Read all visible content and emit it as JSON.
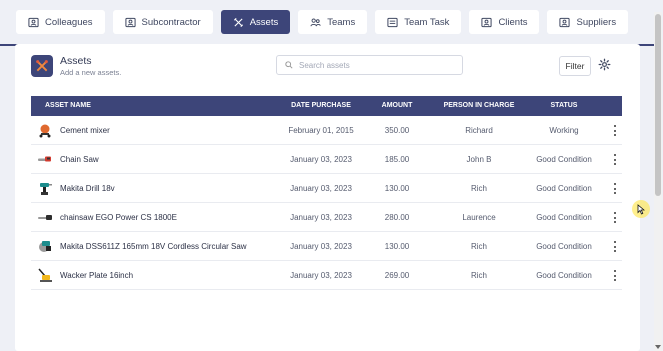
{
  "tabs": [
    {
      "label": "Colleagues",
      "icon": "id-card-icon",
      "active": false
    },
    {
      "label": "Subcontractor",
      "icon": "id-card-icon",
      "active": false
    },
    {
      "label": "Assets",
      "icon": "tools-icon",
      "active": true
    },
    {
      "label": "Teams",
      "icon": "people-icon",
      "active": false
    },
    {
      "label": "Team Task",
      "icon": "task-board-icon",
      "active": false
    },
    {
      "label": "Clients",
      "icon": "id-card-icon",
      "active": false
    },
    {
      "label": "Suppliers",
      "icon": "id-card-icon",
      "active": false
    }
  ],
  "header": {
    "title": "Assets",
    "subtitle": "Add a new assets.",
    "icon": "tools-icon"
  },
  "search": {
    "placeholder": "Search assets",
    "value": ""
  },
  "filter_label": "Filter",
  "table": {
    "columns": [
      "ASSET NAME",
      "DATE PURCHASE",
      "AMOUNT",
      "PERSON IN CHARGE",
      "STATUS"
    ],
    "rows": [
      {
        "name": "Cement mixer",
        "date": "February 01, 2015",
        "amount": "350.00",
        "person": "Richard",
        "status": "Working",
        "thumb": "cement-mixer-thumbnail"
      },
      {
        "name": "Chain Saw",
        "date": "January 03, 2023",
        "amount": "185.00",
        "person": "John B",
        "status": "Good Condition",
        "thumb": "chainsaw-thumbnail"
      },
      {
        "name": "Makita Drill 18v",
        "date": "January 03, 2023",
        "amount": "130.00",
        "person": "Rich",
        "status": "Good Condition",
        "thumb": "drill-thumbnail"
      },
      {
        "name": "chainsaw EGO Power CS 1800E",
        "date": "January 03, 2023",
        "amount": "280.00",
        "person": "Laurence",
        "status": "Good Condition",
        "thumb": "chainsaw-thumbnail"
      },
      {
        "name": "Makita DSS611Z 165mm 18V Cordless Circular Saw",
        "date": "January 03, 2023",
        "amount": "130.00",
        "person": "Rich",
        "status": "Good Condition",
        "thumb": "circular-saw-thumbnail"
      },
      {
        "name": "Wacker Plate 16inch",
        "date": "January 03, 2023",
        "amount": "269.00",
        "person": "Rich",
        "status": "Good Condition",
        "thumb": "plate-compactor-thumbnail"
      }
    ]
  },
  "colors": {
    "accent": "#3d4579",
    "background": "#eef0f6"
  }
}
